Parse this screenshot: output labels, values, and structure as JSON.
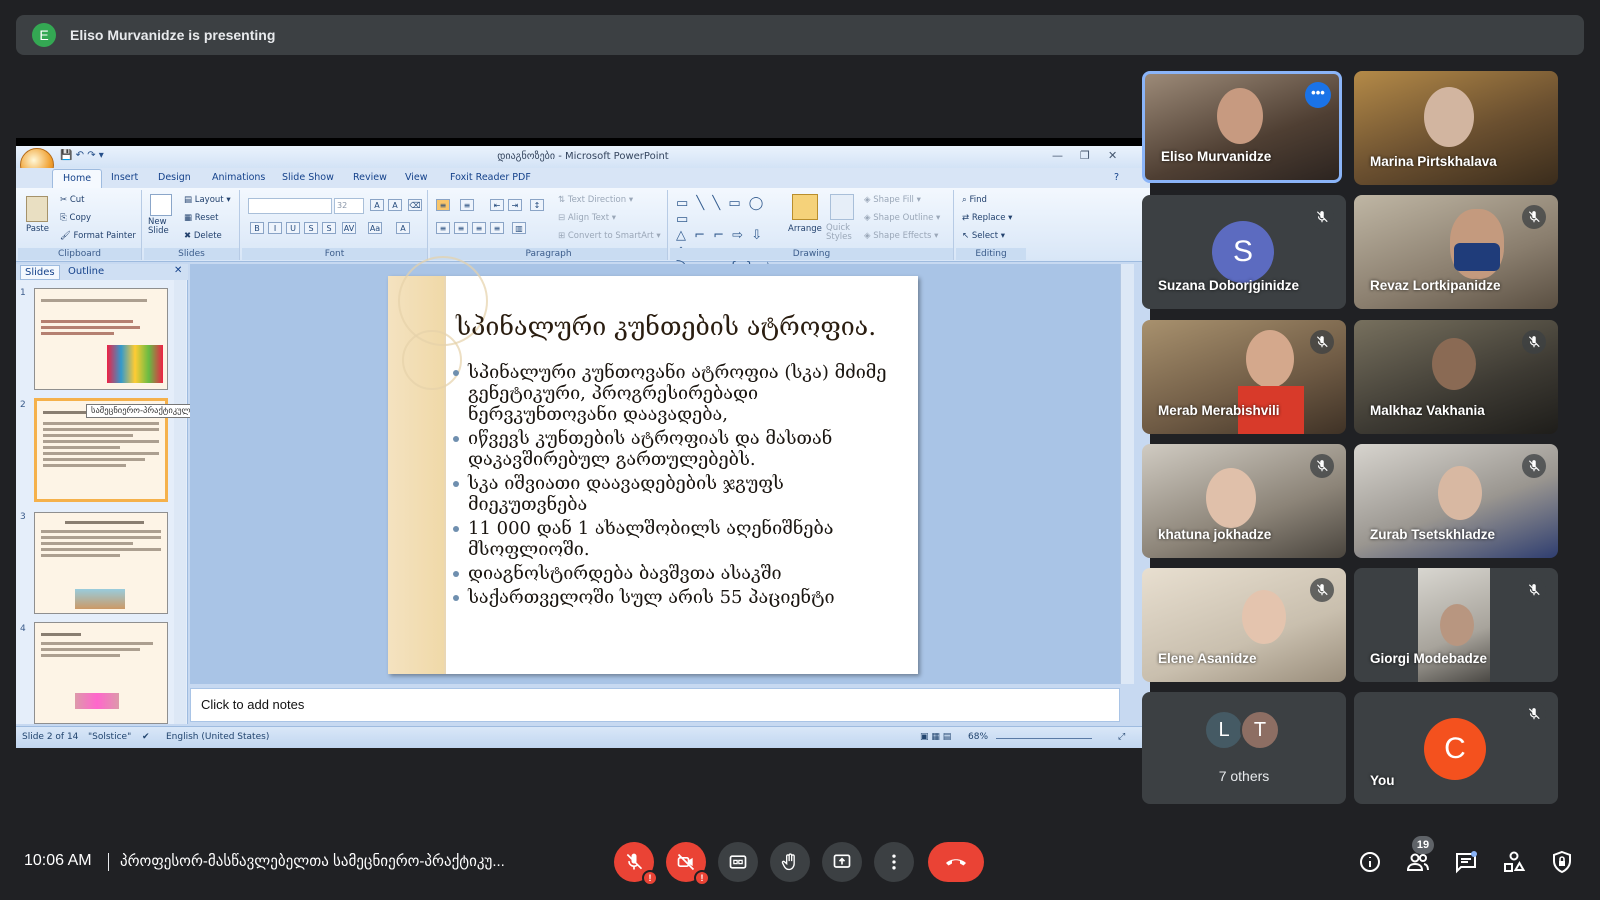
{
  "banner": {
    "avatar_letter": "E",
    "text": "Eliso Murvanidze is presenting"
  },
  "ppt": {
    "window_title": "დიაგნოზები - Microsoft PowerPoint",
    "tabs": [
      "Home",
      "Insert",
      "Design",
      "Animations",
      "Slide Show",
      "Review",
      "View",
      "Foxit Reader PDF"
    ],
    "clipboard": {
      "paste": "Paste",
      "cut": "Cut",
      "copy": "Copy",
      "format_painter": "Format Painter",
      "label": "Clipboard"
    },
    "slides_grp": {
      "new_slide": "New Slide",
      "layout": "Layout",
      "reset": "Reset",
      "delete": "Delete",
      "label": "Slides"
    },
    "font_grp": {
      "size": "32",
      "label": "Font"
    },
    "paragraph": {
      "text_direction": "Text Direction",
      "align_text": "Align Text",
      "convert": "Convert to SmartArt",
      "label": "Paragraph"
    },
    "drawing": {
      "arrange": "Arrange",
      "quick_styles": "Quick Styles",
      "shape_fill": "Shape Fill",
      "shape_outline": "Shape Outline",
      "shape_effects": "Shape Effects",
      "label": "Drawing"
    },
    "editing": {
      "find": "Find",
      "replace": "Replace",
      "select": "Select",
      "label": "Editing"
    },
    "pane_tabs": {
      "slides": "Slides",
      "outline": "Outline"
    },
    "thumb_numbers": [
      "1",
      "2",
      "3",
      "4"
    ],
    "tooltip": "სამეცნიერო-პრაქტიკული ო...",
    "slide": {
      "title": "სპინალური კუნთების ატროფია.",
      "bullets": [
        "სპინალური კუნთოვანი ატროფია (სკა) მძიმე გენეტიკური, პროგრესირებადი ნერვკუნთოვანი დაავადება,",
        "იწვევს კუნთების ატროფიას და მასთან დაკავშირებულ გართულებებს.",
        "სკა იშვიათი დაავადებების ჯგუფს მიეკუთვნება",
        "11 000 დან 1 ახალშობილს აღენიშნება მსოფლიოში.",
        "დიაგნოსტირდება ბავშვთა ასაკში",
        "საქართველოში სულ არის 55 პაციენტი"
      ]
    },
    "notes": "Click to add notes",
    "status": {
      "slide_of": "Slide 2 of 14",
      "theme": "\"Solstice\"",
      "language": "English (United States)",
      "zoom": "68%"
    }
  },
  "participants": [
    {
      "name": "Eliso Murvanidze",
      "bg": "#6b5a4c"
    },
    {
      "name": "Marina Pirtskhalava",
      "bg": "#6f5a3c"
    },
    {
      "name": "Suzana Doborjginidze",
      "avatar": "S",
      "avatar_color": "#5c6bc0"
    },
    {
      "name": "Revaz Lortkipanidze",
      "bg": "#8a7e6e"
    },
    {
      "name": "Merab Merabishvili",
      "bg": "#7a6650"
    },
    {
      "name": "Malkhaz Vakhania",
      "bg": "#4d4a42"
    },
    {
      "name": "khatuna jokhadze",
      "bg": "#8c8478"
    },
    {
      "name": "Zurab Tsetskhladze",
      "bg": "#9a9690"
    },
    {
      "name": "Elene Asanidze",
      "bg": "#c9bfae"
    },
    {
      "name": "Giorgi Modebadze",
      "bg": "#a8a49c"
    }
  ],
  "others": {
    "label": "7 others",
    "a1": "L",
    "a2": "T"
  },
  "you": {
    "label": "You",
    "avatar": "C"
  },
  "bottom": {
    "time": "10:06 AM",
    "meeting": "პროფესორ-მასწავლებელთა სამეცნიერო-პრაქტიკუ...",
    "people_count": "19"
  }
}
